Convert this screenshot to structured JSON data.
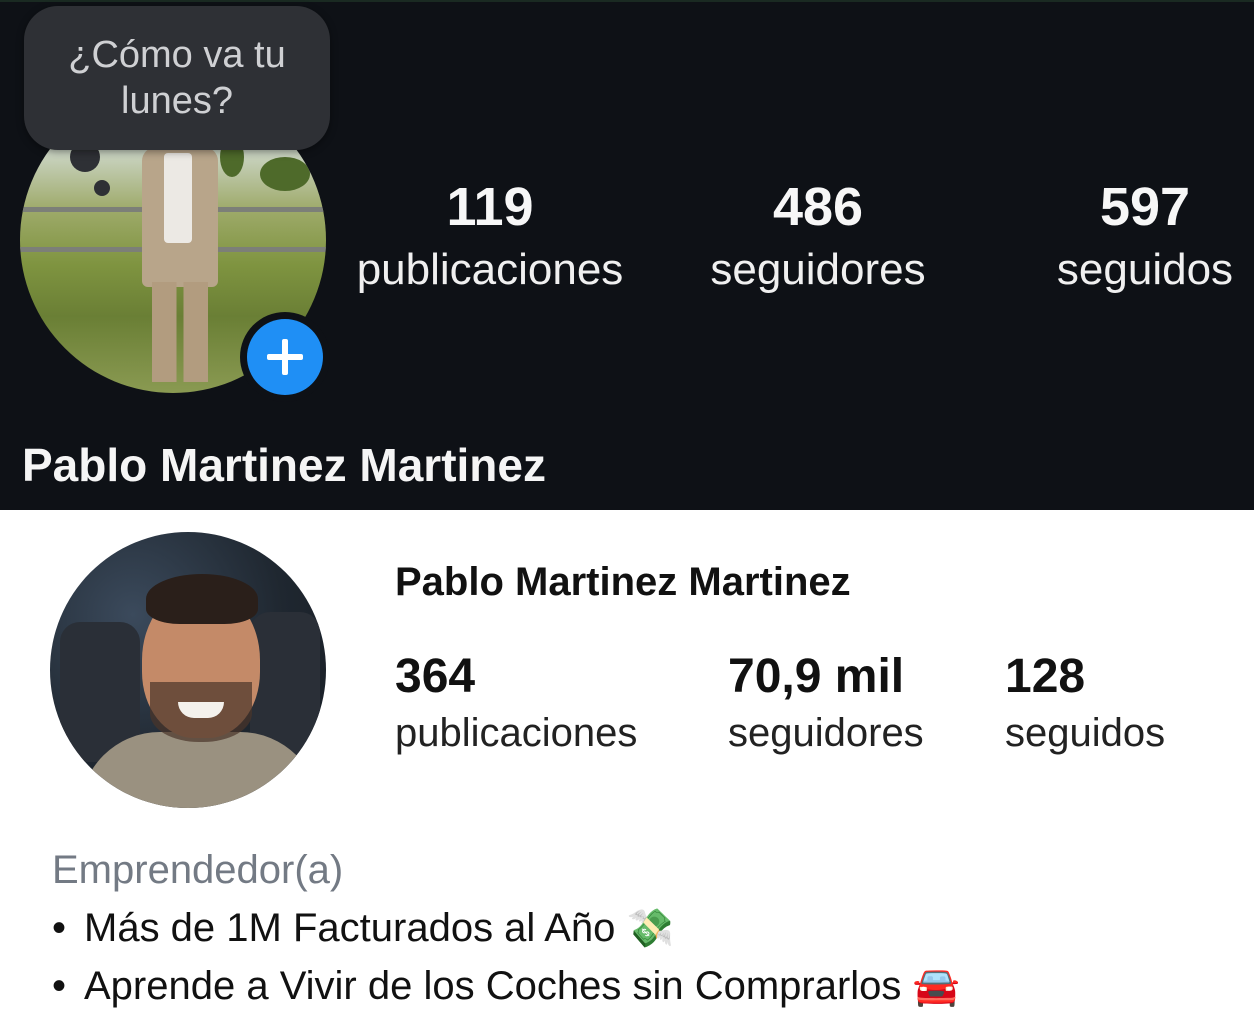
{
  "dark_profile": {
    "note_text": "¿Cómo va tu lunes?",
    "stats": [
      {
        "value": "119",
        "label": "publicaciones"
      },
      {
        "value": "486",
        "label": "seguidores"
      },
      {
        "value": "597",
        "label": "seguidos"
      }
    ],
    "name": "Pablo Martinez Martinez",
    "add_story_icon": "plus-icon",
    "accent_color": "#1f8ff5"
  },
  "light_profile": {
    "name": "Pablo Martinez Martinez",
    "stats": [
      {
        "value": "364",
        "label": "publicaciones"
      },
      {
        "value": "70,9 mil",
        "label": "seguidores"
      },
      {
        "value": "128",
        "label": "seguidos"
      }
    ],
    "category": "Emprendedor(a)",
    "bio": [
      {
        "bullet": "•",
        "text": "Más de 1M Facturados al Año",
        "emoji": "💸"
      },
      {
        "bullet": "•",
        "text": "Aprende a Vivir de los Coches sin Comprarlos",
        "emoji": "🚘"
      }
    ],
    "category_color": "#737a84"
  }
}
